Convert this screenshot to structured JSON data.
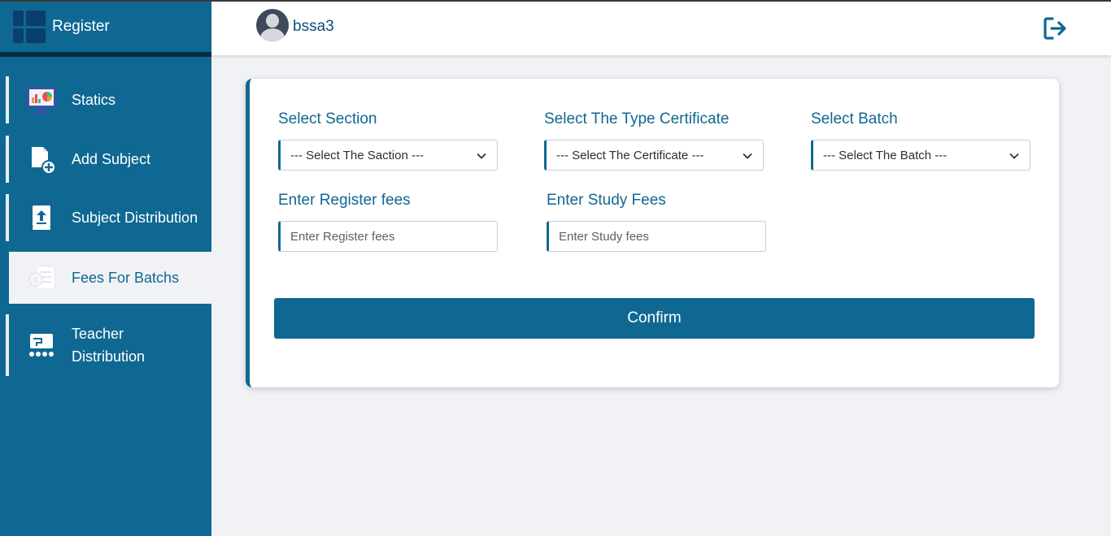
{
  "app": {
    "title": "Register"
  },
  "user": {
    "name": "bssa3"
  },
  "sidebar": {
    "items": [
      {
        "label": "Statics",
        "icon": "statistics-monitor-icon",
        "active": false
      },
      {
        "label": "Add Subject",
        "icon": "add-document-icon",
        "active": false
      },
      {
        "label": "Subject Distribution",
        "icon": "upload-book-icon",
        "active": false
      },
      {
        "label": "Fees For Batchs",
        "icon": "fees-icon",
        "active": true
      },
      {
        "label": "Teacher",
        "label2": "Distribution",
        "icon": "teacher-distribution-icon",
        "active": false
      }
    ]
  },
  "form": {
    "section": {
      "label": "Select Section",
      "selected": "--- Select The Saction ---"
    },
    "certificate": {
      "label": "Select The Type Certificate",
      "selected": "--- Select The Certificate ---"
    },
    "batch": {
      "label": "Select Batch",
      "selected": "--- Select The Batch ---"
    },
    "register_fees": {
      "label": "Enter Register fees",
      "placeholder": "Enter Register fees",
      "value": ""
    },
    "study_fees": {
      "label": "Enter Study Fees",
      "placeholder": "Enter Study fees",
      "value": ""
    },
    "confirm_label": "Confirm"
  },
  "colors": {
    "primary": "#0f6892",
    "page_bg": "#f1f2f6",
    "card_bg": "#ffffff"
  }
}
